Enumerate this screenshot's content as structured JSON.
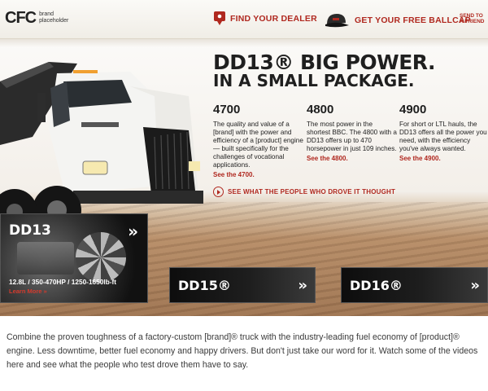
{
  "header": {
    "logo_mark": "CFC",
    "logo_sub": "brand placeholder",
    "find_dealer": "FIND YOUR DEALER",
    "free_ballcap": "GET YOUR FREE BALLCAP",
    "send_line1": "SEND TO",
    "send_line2": "A FRIEND",
    "icons": [
      "map-pin-icon",
      "ballcap-icon"
    ],
    "accent_color": "#b0281f"
  },
  "hero": {
    "headline_line1": "DD13® BIG POWER.",
    "headline_line2": "IN A SMALL PACKAGE.",
    "models": [
      {
        "title": "4700",
        "text": "The quality and value of a [brand] with the power and efficiency of a [product] engine — built specifically for the challenges of vocational applications.",
        "link": "See the 4700."
      },
      {
        "title": "4800",
        "text": "The most power in the shortest BBC. The 4800 with a DD13 offers up to 470 horsepower in just 109 inches.",
        "link": "See the 4800."
      },
      {
        "title": "4900",
        "text": "For short or LTL hauls, the DD13 offers all the power you need, with the efficiency you've always wanted.",
        "link": "See the 4900."
      }
    ],
    "see_people": "SEE WHAT THE PEOPLE WHO DROVE IT THOUGHT"
  },
  "engines": {
    "main": {
      "title": "DD13",
      "chevron": "»",
      "spec": "12.8L / 350-470HP / 1250-1650lb-ft",
      "learn_more": "Learn More »"
    },
    "dd15": {
      "title": "DD15®",
      "chevron": "»"
    },
    "dd16": {
      "title": "DD16®",
      "chevron": "»"
    }
  },
  "body_copy": "Combine the proven toughness of a factory-custom [brand]® truck with the industry-leading fuel economy of [product]® engine. Less downtime, better fuel economy and happy drivers. But don't just take our word for it. Watch some of the videos here and see what the people who test drove them have to say."
}
